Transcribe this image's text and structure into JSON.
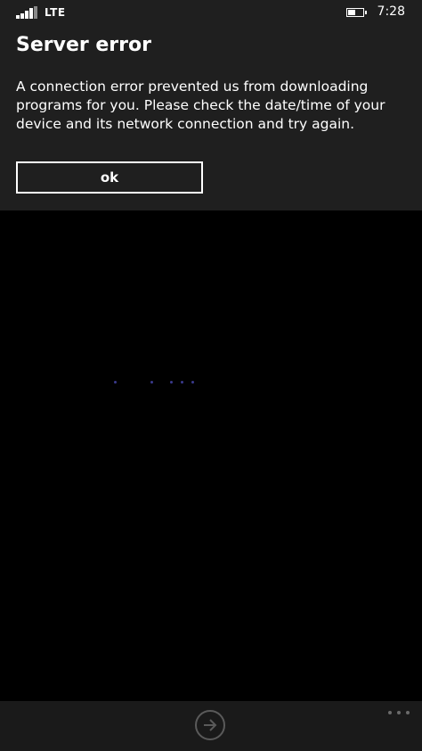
{
  "status_bar": {
    "network": "LTE",
    "time": "7:28",
    "icons": {
      "signal": "signal-strength-icon",
      "battery": "battery-icon"
    },
    "battery_level": 0.45
  },
  "dialog": {
    "title": "Server error",
    "message": "A connection error prevented us from downloading programs for you. Please check the date/time of your device and its network connection and try again.",
    "ok_label": "ok"
  },
  "loading": {
    "dot_color": "#3a3a8c"
  },
  "app_bar": {
    "next_icon": "arrow-right-circle-icon",
    "more_icon": "ellipsis-icon"
  },
  "colors": {
    "background": "#000000",
    "dialog_background": "#1f1f1f",
    "app_bar_background": "#1a1a1a",
    "text": "#ffffff"
  }
}
